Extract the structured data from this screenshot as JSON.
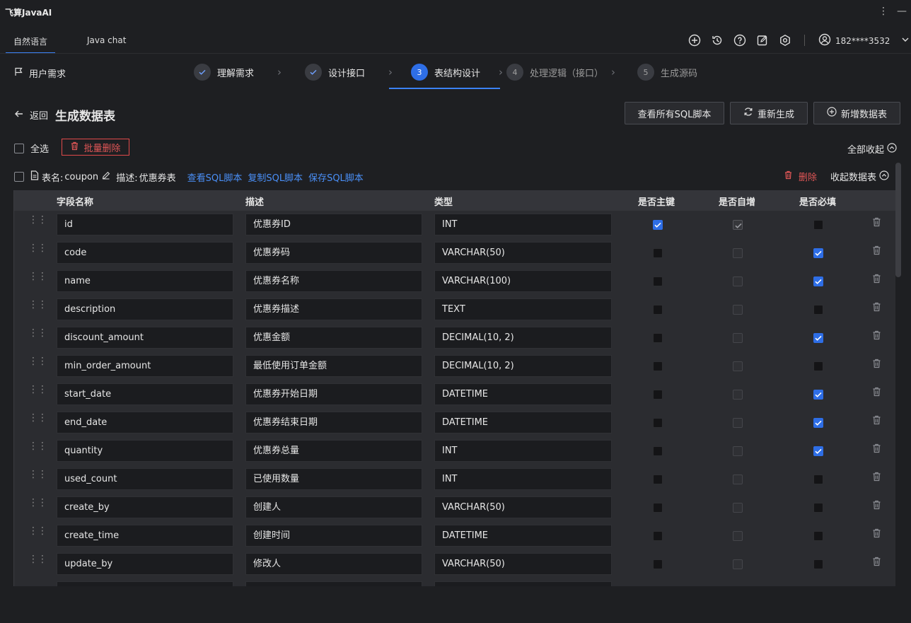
{
  "app": {
    "title": "飞算JavaAI"
  },
  "tabs": [
    {
      "label": "自然语言",
      "active": true
    },
    {
      "label": "Java chat",
      "active": false
    }
  ],
  "header_icons": [
    "add-circle-icon",
    "history-icon",
    "help-icon",
    "edit-icon",
    "settings-icon"
  ],
  "user": {
    "name": "182****3532"
  },
  "requirement": {
    "label": "用户需求"
  },
  "steps": [
    {
      "label": "理解需求",
      "state": "done"
    },
    {
      "label": "设计接口",
      "state": "done"
    },
    {
      "num": "3",
      "label": "表结构设计",
      "state": "active"
    },
    {
      "num": "4",
      "label": "处理逻辑（接口）",
      "state": "todo"
    },
    {
      "num": "5",
      "label": "生成源码",
      "state": "todo"
    }
  ],
  "page": {
    "back_label": "返回",
    "title": "生成数据表"
  },
  "actions": {
    "view_all_sql": "查看所有SQL脚本",
    "regenerate": "重新生成",
    "add_table": "新增数据表"
  },
  "selection": {
    "select_all": "全选",
    "bulk_delete": "批量删除",
    "collapse_all": "全部收起"
  },
  "table": {
    "name_label": "表名:",
    "name": "coupon",
    "desc_label": "描述:",
    "desc": "优惠券表",
    "view_sql": "查看SQL脚本",
    "copy_sql": "复制SQL脚本",
    "save_sql": "保存SQL脚本",
    "delete": "删除",
    "collapse": "收起数据表",
    "columns": [
      "字段名称",
      "描述",
      "类型",
      "是否主键",
      "是否自增",
      "是否必填"
    ],
    "rows": [
      {
        "field": "id",
        "desc": "优惠券ID",
        "type": "INT",
        "pk": true,
        "ai": true,
        "req": false
      },
      {
        "field": "code",
        "desc": "优惠券码",
        "type": "VARCHAR(50)",
        "pk": false,
        "ai": false,
        "req": true
      },
      {
        "field": "name",
        "desc": "优惠券名称",
        "type": "VARCHAR(100)",
        "pk": false,
        "ai": false,
        "req": true
      },
      {
        "field": "description",
        "desc": "优惠券描述",
        "type": "TEXT",
        "pk": false,
        "ai": false,
        "req": false
      },
      {
        "field": "discount_amount",
        "desc": "优惠金额",
        "type": "DECIMAL(10, 2)",
        "pk": false,
        "ai": false,
        "req": true
      },
      {
        "field": "min_order_amount",
        "desc": "最低使用订单金额",
        "type": "DECIMAL(10, 2)",
        "pk": false,
        "ai": false,
        "req": false
      },
      {
        "field": "start_date",
        "desc": "优惠券开始日期",
        "type": "DATETIME",
        "pk": false,
        "ai": false,
        "req": true
      },
      {
        "field": "end_date",
        "desc": "优惠券结束日期",
        "type": "DATETIME",
        "pk": false,
        "ai": false,
        "req": true
      },
      {
        "field": "quantity",
        "desc": "优惠券总量",
        "type": "INT",
        "pk": false,
        "ai": false,
        "req": true
      },
      {
        "field": "used_count",
        "desc": "已使用数量",
        "type": "INT",
        "pk": false,
        "ai": false,
        "req": false
      },
      {
        "field": "create_by",
        "desc": "创建人",
        "type": "VARCHAR(50)",
        "pk": false,
        "ai": false,
        "req": false
      },
      {
        "field": "create_time",
        "desc": "创建时间",
        "type": "DATETIME",
        "pk": false,
        "ai": false,
        "req": false
      },
      {
        "field": "update_by",
        "desc": "修改人",
        "type": "VARCHAR(50)",
        "pk": false,
        "ai": false,
        "req": false
      }
    ]
  }
}
